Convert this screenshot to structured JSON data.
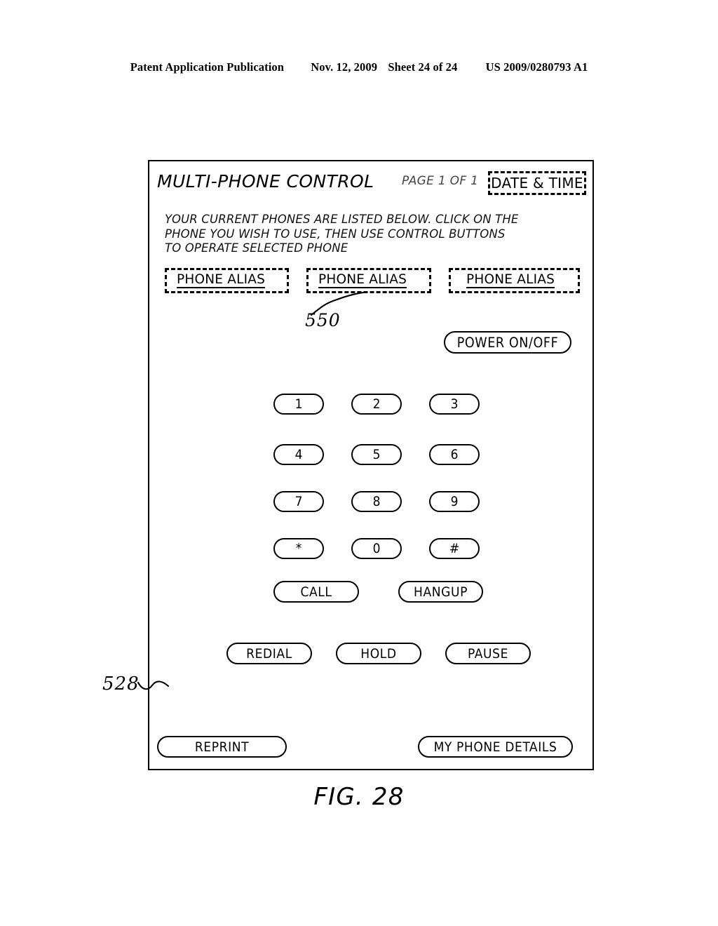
{
  "header": {
    "publication": "Patent Application Publication",
    "date": "Nov. 12, 2009",
    "sheet": "Sheet 24 of 24",
    "patent_number": "US 2009/0280793 A1"
  },
  "figure": {
    "caption": "FIG. 28",
    "screen_reference_numeral": "528",
    "alias_reference_numeral": "550"
  },
  "screen": {
    "title": "MULTI-PHONE CONTROL",
    "page_indicator": "PAGE 1 OF 1",
    "datetime_field": "DATE & TIME",
    "instructions": {
      "line1": "YOUR CURRENT PHONES ARE LISTED BELOW. CLICK ON THE",
      "line2": "PHONE YOU WISH TO USE, THEN USE CONTROL BUTTONS",
      "line3": "TO OPERATE SELECTED PHONE"
    },
    "phone_aliases": [
      {
        "label": "PHONE ALIAS"
      },
      {
        "label": "PHONE ALIAS"
      },
      {
        "label": "PHONE ALIAS"
      }
    ],
    "power_button": "POWER ON/OFF",
    "keypad": [
      {
        "label": "1"
      },
      {
        "label": "2"
      },
      {
        "label": "3"
      },
      {
        "label": "4"
      },
      {
        "label": "5"
      },
      {
        "label": "6"
      },
      {
        "label": "7"
      },
      {
        "label": "8"
      },
      {
        "label": "9"
      },
      {
        "label": "*"
      },
      {
        "label": "0"
      },
      {
        "label": "#"
      }
    ],
    "call_controls": {
      "call": "CALL",
      "hangup": "HANGUP"
    },
    "secondary_controls": {
      "redial": "REDIAL",
      "hold": "HOLD",
      "pause": "PAUSE"
    },
    "footer_controls": {
      "reprint": "REPRINT",
      "my_phone_details": "MY PHONE DETAILS"
    }
  },
  "colors": {
    "ink": "#000000",
    "paper": "#ffffff"
  }
}
